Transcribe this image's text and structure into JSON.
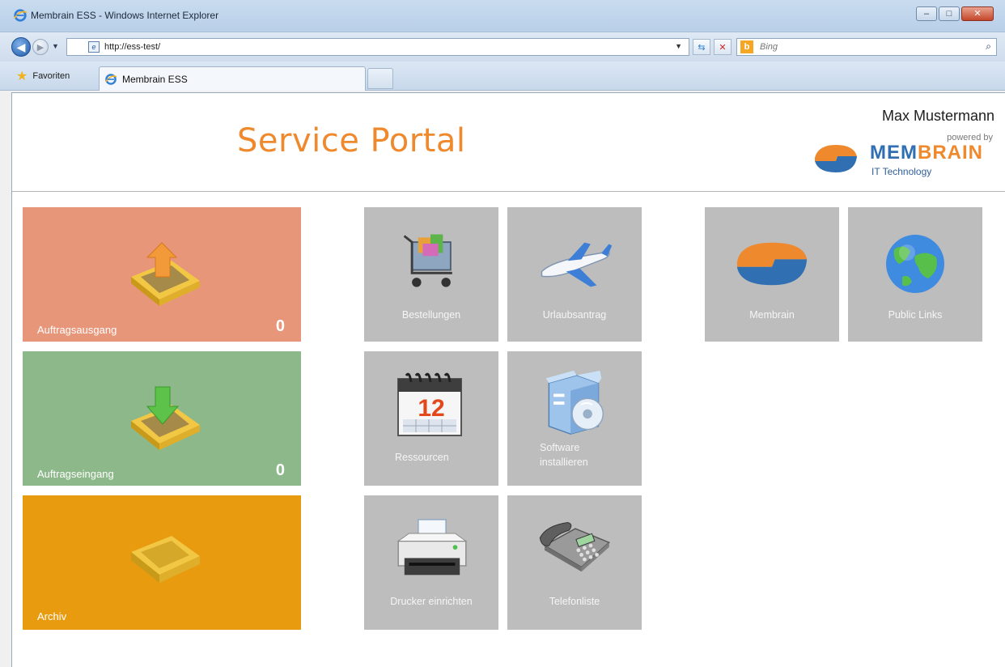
{
  "window": {
    "title": "Membrain ESS - Windows Internet Explorer",
    "controls": {
      "minimize": "–",
      "maximize": "□",
      "close": "✕"
    }
  },
  "address": {
    "url": "http://ess-test/",
    "search_placeholder": "Bing",
    "back_icon": "back-arrow-icon",
    "forward_icon": "forward-arrow-icon"
  },
  "tabs": {
    "favorites_label": "Favoriten",
    "active_tab_label": "Membrain ESS"
  },
  "header": {
    "title": "Service Portal",
    "user": "Max Mustermann",
    "powered_by": "powered by",
    "brand_light": "MEM",
    "brand_strong": "BRAIN",
    "brand_sub": "IT Technology"
  },
  "tiles": {
    "outbox": {
      "label": "Auftragsausgang",
      "count": "0",
      "color": "#e8967a"
    },
    "inbox": {
      "label": "Auftragseingang",
      "count": "0",
      "color": "#8db98a"
    },
    "archive": {
      "label": "Archiv",
      "color": "#e99b10"
    },
    "orders": {
      "label": "Bestellungen"
    },
    "vacation": {
      "label": "Urlaubsantrag"
    },
    "resources": {
      "label": "Ressourcen",
      "calendar_day": "12"
    },
    "software_line1": "Software",
    "software_line2": "installieren",
    "printer": {
      "label": "Drucker einrichten"
    },
    "phone": {
      "label": "Telefonliste"
    },
    "membrain": {
      "label": "Membrain"
    },
    "public_links": {
      "label": "Public Links"
    }
  },
  "colors": {
    "accent": "#ee8a2d",
    "brand_blue": "#2f6fb2",
    "tile_gray": "#bdbdbd"
  }
}
